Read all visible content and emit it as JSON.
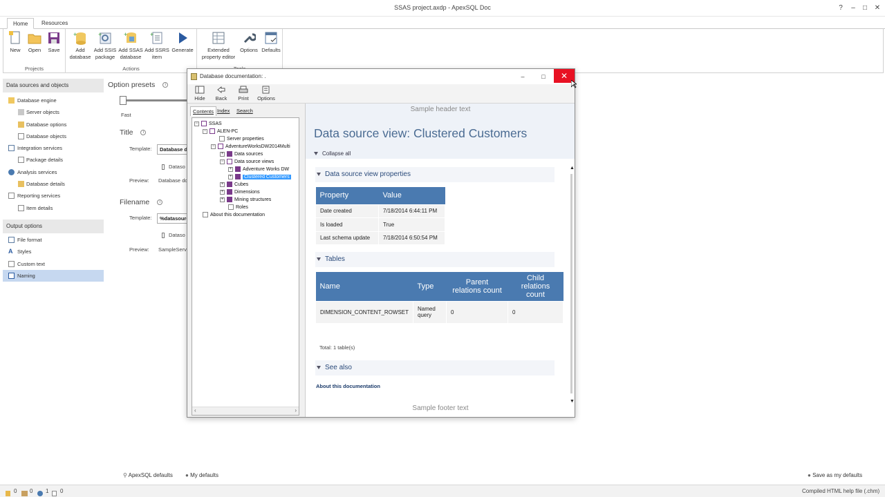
{
  "app": {
    "title": "SSAS project.axdp - ApexSQL Doc",
    "help_label": "?"
  },
  "tabs": [
    {
      "label": "Home"
    },
    {
      "label": "Resources"
    }
  ],
  "ribbon": {
    "groups": [
      {
        "label": "Projects",
        "buttons": [
          {
            "label": "New"
          },
          {
            "label": "Open"
          },
          {
            "label": "Save"
          }
        ]
      },
      {
        "label": "Actions",
        "buttons": [
          {
            "label": "Add database"
          },
          {
            "label": "Add SSIS package"
          },
          {
            "label": "Add SSAS database"
          },
          {
            "label": "Add SSRS item"
          },
          {
            "label": "Generate"
          }
        ]
      },
      {
        "label": "Tools",
        "buttons": [
          {
            "label": "Extended property editor"
          },
          {
            "label": "Options"
          },
          {
            "label": "Defaults"
          }
        ]
      }
    ]
  },
  "sidebar": {
    "section1": "Data sources and objects",
    "items1": [
      {
        "label": "Database engine"
      },
      {
        "label": "Server objects"
      },
      {
        "label": "Database options"
      },
      {
        "label": "Database objects"
      },
      {
        "label": "Integration services"
      },
      {
        "label": "Package details"
      },
      {
        "label": "Analysis services"
      },
      {
        "label": "Database details"
      },
      {
        "label": "Reporting services"
      },
      {
        "label": "Item details"
      }
    ],
    "section2": "Output options",
    "items2": [
      {
        "label": "File format"
      },
      {
        "label": "Styles"
      },
      {
        "label": "Custom text"
      },
      {
        "label": "Naming"
      }
    ]
  },
  "options": {
    "presets_label": "Option presets",
    "slider_label": "Fast",
    "title_label": "Title",
    "title_template_label": "Template:",
    "title_template_value": "Database doc",
    "title_chip": "Dataso",
    "title_preview_label": "Preview:",
    "title_preview_value": "Database do",
    "filename_label": "Filename",
    "filename_template_label": "Template:",
    "filename_template_value": "%datasourc",
    "filename_chip": "Dataso",
    "filename_preview_label": "Preview:",
    "filename_preview_value": "SampleServe"
  },
  "bottom": {
    "apex_defaults": "ApexSQL defaults",
    "my_defaults": "My defaults",
    "save_defaults": "Save as my defaults"
  },
  "status": {
    "c1": "0",
    "c2": "0",
    "c3": "1",
    "c4": "0",
    "right": "Compiled HTML help file (.chm)"
  },
  "dialog": {
    "title": "Database documentation: .",
    "toolbar": [
      {
        "label": "Hide"
      },
      {
        "label": "Back"
      },
      {
        "label": "Print"
      },
      {
        "label": "Options"
      }
    ],
    "nav_tabs": [
      {
        "label": "Contents"
      },
      {
        "label": "Index"
      },
      {
        "label": "Search"
      }
    ],
    "tree": [
      {
        "label": "SSAS",
        "pm": "−"
      },
      {
        "label": "ALEN-PC",
        "pm": "−"
      },
      {
        "label": "Server properties",
        "pm": ""
      },
      {
        "label": "AdventureWorksDW2014Multi",
        "pm": "−"
      },
      {
        "label": "Data sources",
        "pm": "+"
      },
      {
        "label": "Data source views",
        "pm": "−"
      },
      {
        "label": "Adventure Works DW",
        "pm": "+"
      },
      {
        "label": "Clustered Customers",
        "pm": "+"
      },
      {
        "label": "Cubes",
        "pm": "+"
      },
      {
        "label": "Dimensions",
        "pm": "+"
      },
      {
        "label": "Mining structures",
        "pm": "+"
      },
      {
        "label": "Roles",
        "pm": ""
      },
      {
        "label": "About this documentation",
        "pm": ""
      }
    ],
    "doc": {
      "header": "Sample header text",
      "title": "Data source view: Clustered Customers",
      "collapse_all": "Collapse all",
      "props_heading": "Data source view properties",
      "props_cols": [
        "Property",
        "Value"
      ],
      "props_rows": [
        [
          "Date created",
          "7/18/2014 6:44:11 PM"
        ],
        [
          "Is loaded",
          "True"
        ],
        [
          "Last schema update",
          "7/18/2014 6:50:54 PM"
        ]
      ],
      "tables_heading": "Tables",
      "tables_cols": [
        "Name",
        "Type",
        "Parent relations count",
        "Child relations count"
      ],
      "tables_rows": [
        [
          "DIMENSION_CONTENT_ROWSET",
          "Named query",
          "0",
          "0"
        ]
      ],
      "total": "Total: 1 table(s)",
      "see_also_heading": "See also",
      "see_also_link": "About this documentation",
      "footer": "Sample footer text"
    }
  },
  "colors": {
    "accent": "#4a7ab0",
    "close": "#e81123",
    "selection": "#c6d8f0",
    "title_text": "#4a6b92"
  }
}
